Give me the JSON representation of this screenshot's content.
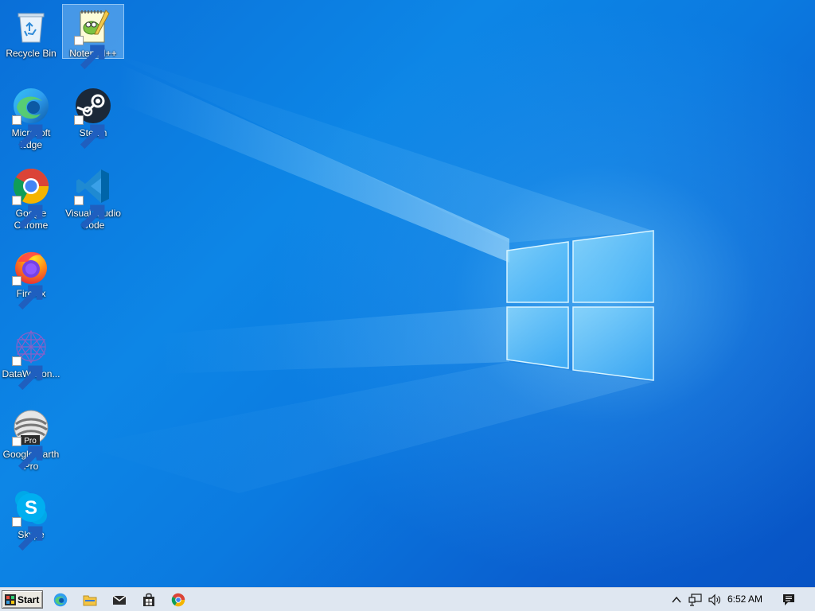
{
  "desktop": {
    "icons": [
      {
        "id": "recycle-bin",
        "label": "Recycle Bin",
        "icon": "recycle-bin-icon",
        "shortcut": false,
        "selected": false
      },
      {
        "id": "notepad-plus-plus",
        "label": "Notepad++",
        "icon": "notepad-plus-plus-icon",
        "shortcut": true,
        "selected": true
      },
      {
        "id": "microsoft-edge",
        "label": "Microsoft Edge",
        "icon": "edge-icon",
        "shortcut": true,
        "selected": false
      },
      {
        "id": "steam",
        "label": "Steam",
        "icon": "steam-icon",
        "shortcut": true,
        "selected": false
      },
      {
        "id": "google-chrome",
        "label": "Google Chrome",
        "icon": "chrome-icon",
        "shortcut": true,
        "selected": false
      },
      {
        "id": "visual-studio-code",
        "label": "Visual Studio Code",
        "icon": "vscode-icon",
        "shortcut": true,
        "selected": false
      },
      {
        "id": "firefox",
        "label": "Firefox",
        "icon": "firefox-icon",
        "shortcut": true,
        "selected": false
      },
      {
        "id": "datawagon",
        "label": "DataWagon...",
        "icon": "datawagon-icon",
        "shortcut": true,
        "selected": false
      },
      {
        "id": "google-earth-pro",
        "label": "Google Earth Pro",
        "icon": "google-earth-pro-icon",
        "shortcut": true,
        "selected": false,
        "badge": "Pro"
      },
      {
        "id": "skype",
        "label": "Skype",
        "icon": "skype-icon",
        "shortcut": true,
        "selected": false
      }
    ]
  },
  "taskbar": {
    "start_label": "Start",
    "pinned": [
      {
        "name": "edge-taskbar-button",
        "icon": "edge-icon"
      },
      {
        "name": "file-explorer-taskbar-button",
        "icon": "folder-icon"
      },
      {
        "name": "mail-taskbar-button",
        "icon": "mail-icon"
      },
      {
        "name": "store-taskbar-button",
        "icon": "store-icon"
      },
      {
        "name": "chrome-taskbar-button",
        "icon": "chrome-icon"
      }
    ],
    "tray": {
      "show_hidden_icon": "chevron-up-icon",
      "network_icon": "network-icon",
      "volume_icon": "volume-icon",
      "clock": "6:52 AM",
      "notification_icon": "action-center-icon"
    }
  },
  "colors": {
    "desktop_blue": "#0b7ae0",
    "taskbar_bg": "#dfe7f1",
    "selection": "#b4dcff"
  }
}
